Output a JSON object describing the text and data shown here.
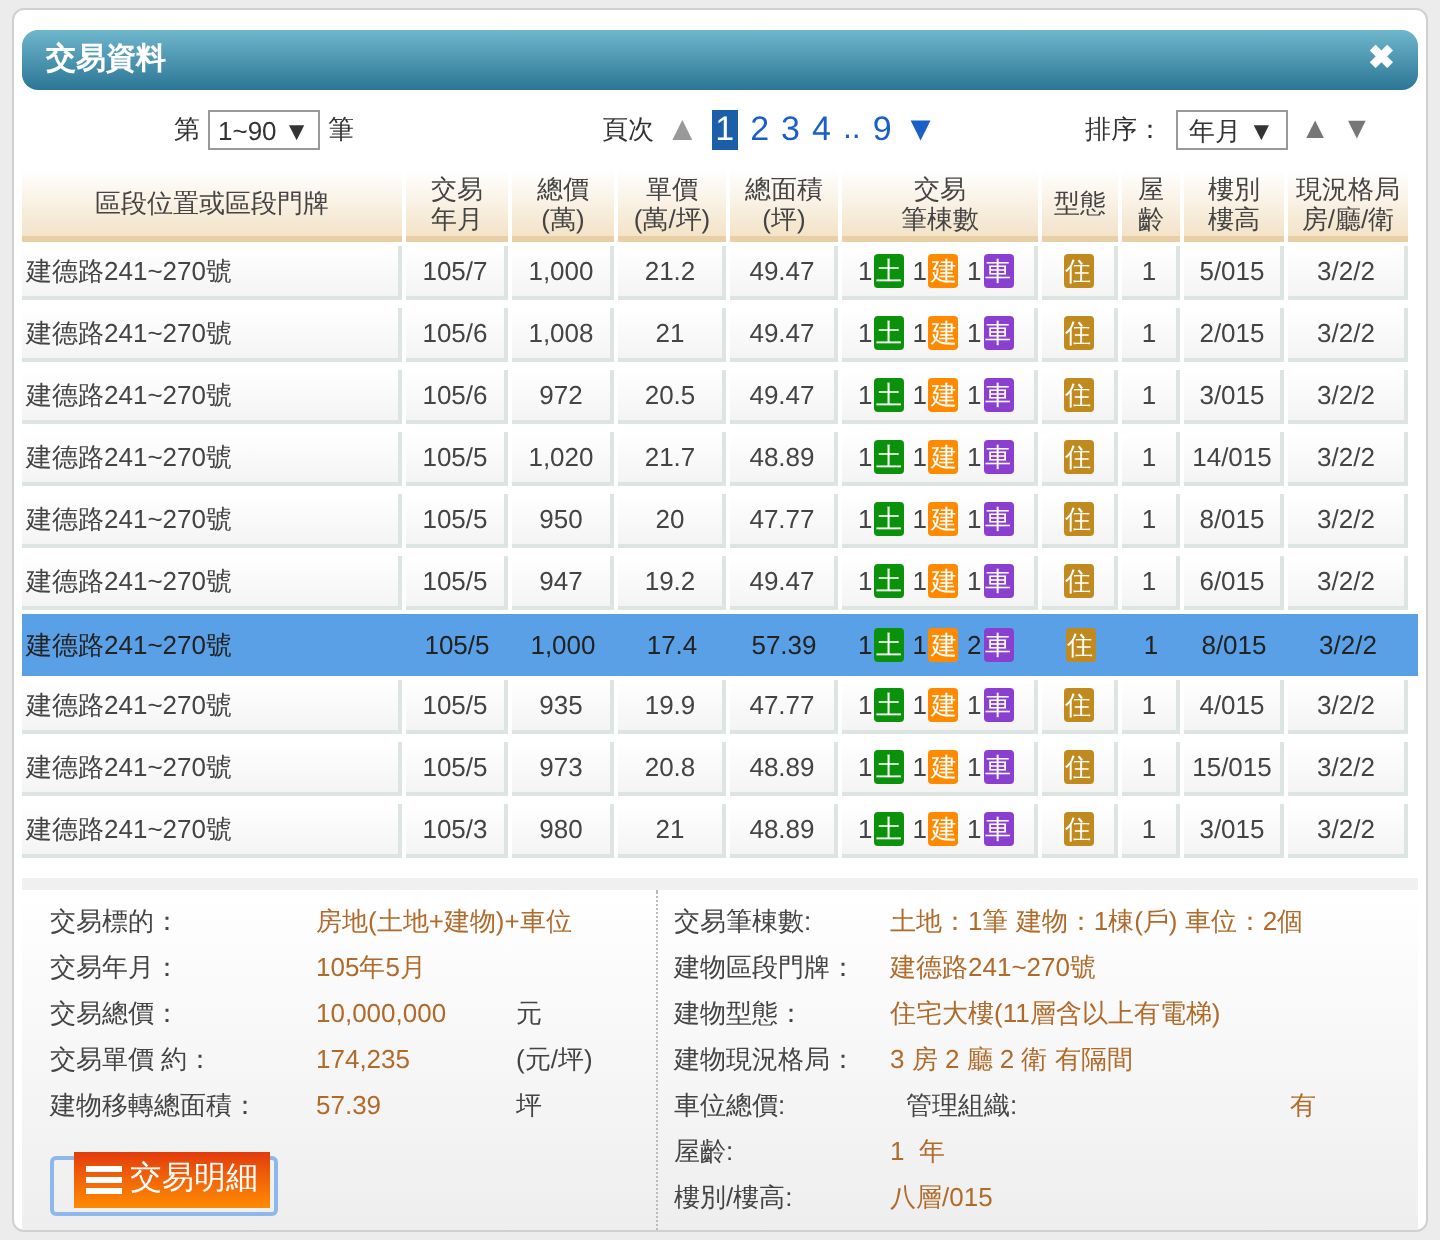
{
  "window": {
    "title": "交易資料",
    "close": "✖"
  },
  "pager": {
    "prefix": "第",
    "range": "1~90 ▼",
    "suffix": "筆",
    "page_label": "頁次",
    "prev": "▲",
    "pages": [
      {
        "label": "1",
        "selected": true
      },
      {
        "label": "2",
        "selected": false
      },
      {
        "label": "3",
        "selected": false
      },
      {
        "label": "4",
        "selected": false
      },
      {
        "label": "..",
        "kind": "gap"
      },
      {
        "label": "9",
        "selected": false
      }
    ],
    "next": "▼",
    "sort_label": "排序：",
    "sort": "年月 ▼",
    "sort_up": "▲",
    "sort_down": "▼"
  },
  "table": {
    "columns": [
      "區段位置或區段門牌",
      "交易年月",
      "總價\n(萬)",
      "單價\n(萬/坪)",
      "總面積\n(坪)",
      "交易筆棟數",
      "型態",
      "屋齡",
      "樓別樓高",
      "現況格局房/廳/衛"
    ],
    "rows": [
      {
        "selected": false,
        "cells": [
          "建德路241~270號",
          "105/7",
          "1,000",
          "21.2",
          "49.47"
        ],
        "counts": [
          {
            "n": "1",
            "badge": "土",
            "color": "#0a930a"
          },
          {
            "n": "1",
            "badge": "建",
            "color": "#ff8a00"
          },
          {
            "n": "1",
            "badge": "車",
            "color": "#8a3fd1"
          }
        ],
        "type": "住",
        "tail": [
          "1",
          "5/015",
          "3/2/2"
        ]
      },
      {
        "selected": false,
        "cells": [
          "建德路241~270號",
          "105/6",
          "1,008",
          "21",
          "49.47"
        ],
        "counts": [
          {
            "n": "1",
            "badge": "土",
            "color": "#0a930a"
          },
          {
            "n": "1",
            "badge": "建",
            "color": "#ff8a00"
          },
          {
            "n": "1",
            "badge": "車",
            "color": "#8a3fd1"
          }
        ],
        "type": "住",
        "tail": [
          "1",
          "2/015",
          "3/2/2"
        ]
      },
      {
        "selected": false,
        "cells": [
          "建德路241~270號",
          "105/6",
          "972",
          "20.5",
          "49.47"
        ],
        "counts": [
          {
            "n": "1",
            "badge": "土",
            "color": "#0a930a"
          },
          {
            "n": "1",
            "badge": "建",
            "color": "#ff8a00"
          },
          {
            "n": "1",
            "badge": "車",
            "color": "#8a3fd1"
          }
        ],
        "type": "住",
        "tail": [
          "1",
          "3/015",
          "3/2/2"
        ]
      },
      {
        "selected": false,
        "cells": [
          "建德路241~270號",
          "105/5",
          "1,020",
          "21.7",
          "48.89"
        ],
        "counts": [
          {
            "n": "1",
            "badge": "土",
            "color": "#0a930a"
          },
          {
            "n": "1",
            "badge": "建",
            "color": "#ff8a00"
          },
          {
            "n": "1",
            "badge": "車",
            "color": "#8a3fd1"
          }
        ],
        "type": "住",
        "tail": [
          "1",
          "14/015",
          "3/2/2"
        ]
      },
      {
        "selected": false,
        "cells": [
          "建德路241~270號",
          "105/5",
          "950",
          "20",
          "47.77"
        ],
        "counts": [
          {
            "n": "1",
            "badge": "土",
            "color": "#0a930a"
          },
          {
            "n": "1",
            "badge": "建",
            "color": "#ff8a00"
          },
          {
            "n": "1",
            "badge": "車",
            "color": "#8a3fd1"
          }
        ],
        "type": "住",
        "tail": [
          "1",
          "8/015",
          "3/2/2"
        ]
      },
      {
        "selected": false,
        "cells": [
          "建德路241~270號",
          "105/5",
          "947",
          "19.2",
          "49.47"
        ],
        "counts": [
          {
            "n": "1",
            "badge": "土",
            "color": "#0a930a"
          },
          {
            "n": "1",
            "badge": "建",
            "color": "#ff8a00"
          },
          {
            "n": "1",
            "badge": "車",
            "color": "#8a3fd1"
          }
        ],
        "type": "住",
        "tail": [
          "1",
          "6/015",
          "3/2/2"
        ]
      },
      {
        "selected": true,
        "cells": [
          "建德路241~270號",
          "105/5",
          "1,000",
          "17.4",
          "57.39"
        ],
        "counts": [
          {
            "n": "1",
            "badge": "土",
            "color": "#0a930a"
          },
          {
            "n": "1",
            "badge": "建",
            "color": "#ff8a00"
          },
          {
            "n": "2",
            "badge": "車",
            "color": "#8a3fd1"
          }
        ],
        "type": "住",
        "tail": [
          "1",
          "8/015",
          "3/2/2"
        ]
      },
      {
        "selected": false,
        "cells": [
          "建德路241~270號",
          "105/5",
          "935",
          "19.9",
          "47.77"
        ],
        "counts": [
          {
            "n": "1",
            "badge": "土",
            "color": "#0a930a"
          },
          {
            "n": "1",
            "badge": "建",
            "color": "#ff8a00"
          },
          {
            "n": "1",
            "badge": "車",
            "color": "#8a3fd1"
          }
        ],
        "type": "住",
        "tail": [
          "1",
          "4/015",
          "3/2/2"
        ]
      },
      {
        "selected": false,
        "cells": [
          "建德路241~270號",
          "105/5",
          "973",
          "20.8",
          "48.89"
        ],
        "counts": [
          {
            "n": "1",
            "badge": "土",
            "color": "#0a930a"
          },
          {
            "n": "1",
            "badge": "建",
            "color": "#ff8a00"
          },
          {
            "n": "1",
            "badge": "車",
            "color": "#8a3fd1"
          }
        ],
        "type": "住",
        "tail": [
          "1",
          "15/015",
          "3/2/2"
        ]
      },
      {
        "selected": false,
        "cells": [
          "建德路241~270號",
          "105/3",
          "980",
          "21",
          "48.89"
        ],
        "counts": [
          {
            "n": "1",
            "badge": "土",
            "color": "#0a930a"
          },
          {
            "n": "1",
            "badge": "建",
            "color": "#ff8a00"
          },
          {
            "n": "1",
            "badge": "車",
            "color": "#8a3fd1"
          }
        ],
        "type": "住",
        "tail": [
          "1",
          "3/015",
          "3/2/2"
        ]
      }
    ]
  },
  "detail": {
    "left": [
      {
        "label": "交易標的：",
        "value": "房地(土地+建物)+車位"
      },
      {
        "label": "交易年月：",
        "value": "105年5月"
      },
      {
        "label": "交易總價：",
        "value": "10,000,000",
        "unit": "元"
      },
      {
        "label": "交易單價 約：",
        "value": "174,235",
        "unit": "(元/坪)"
      },
      {
        "label": "建物移轉總面積：",
        "value": "57.39",
        "unit": "坪"
      }
    ],
    "button": "交易明細",
    "right": [
      {
        "kind": "pair",
        "label": "交易筆棟數:",
        "value": "土地：1筆 建物：1棟(戶) 車位：2個"
      },
      {
        "kind": "pair",
        "label": "建物區段門牌：",
        "value": "建德路241~270號"
      },
      {
        "kind": "pair",
        "label": "建物型態：",
        "value": "住宅大樓(11層含以上有電梯)"
      },
      {
        "kind": "pair",
        "label": "建物現況格局：",
        "value": "3 房 2 廳 2 衛 有隔間"
      },
      {
        "kind": "double",
        "label": "車位總價:",
        "label_2": "管理組織:",
        "value": "有"
      },
      {
        "kind": "pair",
        "label": "屋齡:",
        "value": "1  年"
      },
      {
        "kind": "pair",
        "label": "樓別/樓高:",
        "value": "八層/015"
      }
    ]
  }
}
